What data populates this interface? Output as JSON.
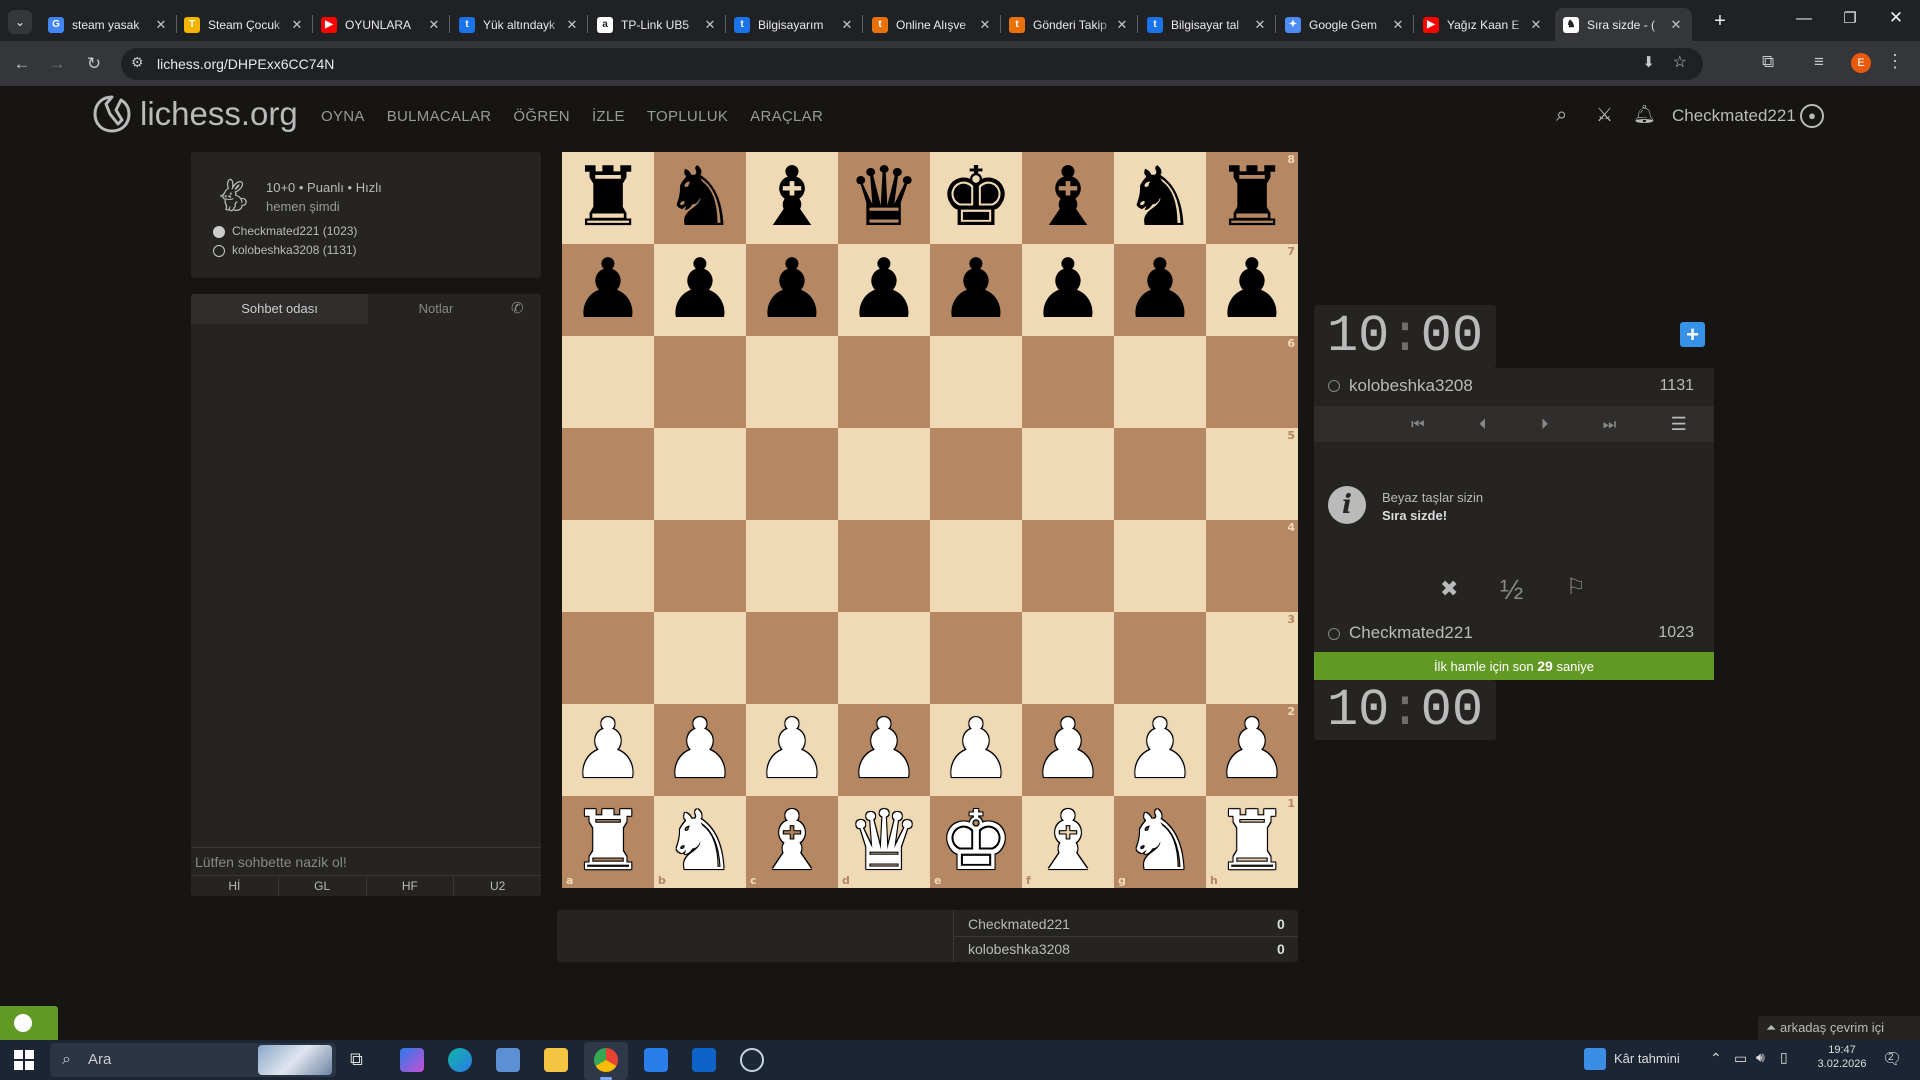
{
  "browser": {
    "tabs": [
      {
        "label": "steam yasak",
        "icon": "google-icon",
        "color": "#4285f4",
        "glyph": "G"
      },
      {
        "label": "Steam Çocuk",
        "icon": "t-icon",
        "color": "#f4b400",
        "glyph": "T"
      },
      {
        "label": "OYUNLARA",
        "icon": "youtube-icon",
        "color": "#ff0000",
        "glyph": "▶"
      },
      {
        "label": "Yük altındayk",
        "icon": "t-icon",
        "color": "#1a73e8",
        "glyph": "t"
      },
      {
        "label": "TP-Link UB5",
        "icon": "amazon-icon",
        "color": "#ffffff",
        "glyph": "a"
      },
      {
        "label": "Bilgisayarım",
        "icon": "t-icon",
        "color": "#1a73e8",
        "glyph": "t"
      },
      {
        "label": "Online Alışve",
        "icon": "store-icon",
        "color": "#e8710a",
        "glyph": "t"
      },
      {
        "label": "Gönderi Takip",
        "icon": "store-icon",
        "color": "#e8710a",
        "glyph": "t"
      },
      {
        "label": "Bilgisayar tal",
        "icon": "t-icon",
        "color": "#1a73e8",
        "glyph": "t"
      },
      {
        "label": "Google Gem",
        "icon": "gemini-icon",
        "color": "#4e8cf5",
        "glyph": "✦"
      },
      {
        "label": "Yağız Kaan E",
        "icon": "youtube-icon",
        "color": "#ff0000",
        "glyph": "▶"
      },
      {
        "label": "Sıra sizde - (",
        "icon": "lichess-icon",
        "color": "#ffffff",
        "glyph": "♞",
        "active": true
      }
    ],
    "url": "lichess.org/DHPExx6CC74N",
    "profile_initial": "E"
  },
  "site": {
    "logo_text": "lichess.org",
    "nav": [
      "OYNA",
      "BULMACALAR",
      "ÖĞREN",
      "İZLE",
      "TOPLULUK",
      "ARAÇLAR"
    ],
    "username": "Checkmated221"
  },
  "game": {
    "type_line": "10+0 • Puanlı • Hızlı",
    "time_ago": "hemen şimdi",
    "white_player": "Checkmated221 (1023)",
    "black_player": "kolobeshka3208 (1131)"
  },
  "chat": {
    "tab_room": "Sohbet odası",
    "tab_notes": "Notlar",
    "input_placeholder": "Lütfen sohbette nazik ol!",
    "presets": [
      "Hİ",
      "GL",
      "HF",
      "U2"
    ]
  },
  "board": {
    "ranks": [
      "8",
      "7",
      "6",
      "5",
      "4",
      "3",
      "2",
      "1"
    ],
    "files": [
      "a",
      "b",
      "c",
      "d",
      "e",
      "f",
      "g",
      "h"
    ],
    "position": [
      [
        "r",
        "n",
        "b",
        "q",
        "k",
        "b",
        "n",
        "r"
      ],
      [
        "p",
        "p",
        "p",
        "p",
        "p",
        "p",
        "p",
        "p"
      ],
      [
        "",
        "",
        "",
        "",
        "",
        "",
        "",
        ""
      ],
      [
        "",
        "",
        "",
        "",
        "",
        "",
        "",
        ""
      ],
      [
        "",
        "",
        "",
        "",
        "",
        "",
        "",
        ""
      ],
      [
        "",
        "",
        "",
        "",
        "",
        "",
        "",
        ""
      ],
      [
        "P",
        "P",
        "P",
        "P",
        "P",
        "P",
        "P",
        "P"
      ],
      [
        "R",
        "N",
        "B",
        "Q",
        "K",
        "B",
        "N",
        "R"
      ]
    ],
    "light_color": "#f0d9b5",
    "dark_color": "#b58863"
  },
  "clocks": {
    "opponent_time": "10:00",
    "player_time": "10:00",
    "opponent_name": "kolobeshka3208",
    "opponent_rating": "1131",
    "player_name": "Checkmated221",
    "player_rating": "1023",
    "info_line1": "Beyaz taşlar sizin",
    "info_line2": "Sıra sizde!",
    "first_move_prefix": "İlk hamle için son ",
    "first_move_seconds": "29",
    "first_move_suffix": " saniye",
    "draw_label": "½"
  },
  "crosstable": {
    "rows": [
      {
        "name": "Checkmated221",
        "score": "0"
      },
      {
        "name": "kolobeshka3208",
        "score": "0"
      }
    ]
  },
  "friends": {
    "label": "arkadaş çevrim içi"
  },
  "taskbar": {
    "search_label": "Ara",
    "weather": "Kâr tahmini",
    "time": "19:47",
    "date": "3.02.2026",
    "notification_count": "2"
  }
}
